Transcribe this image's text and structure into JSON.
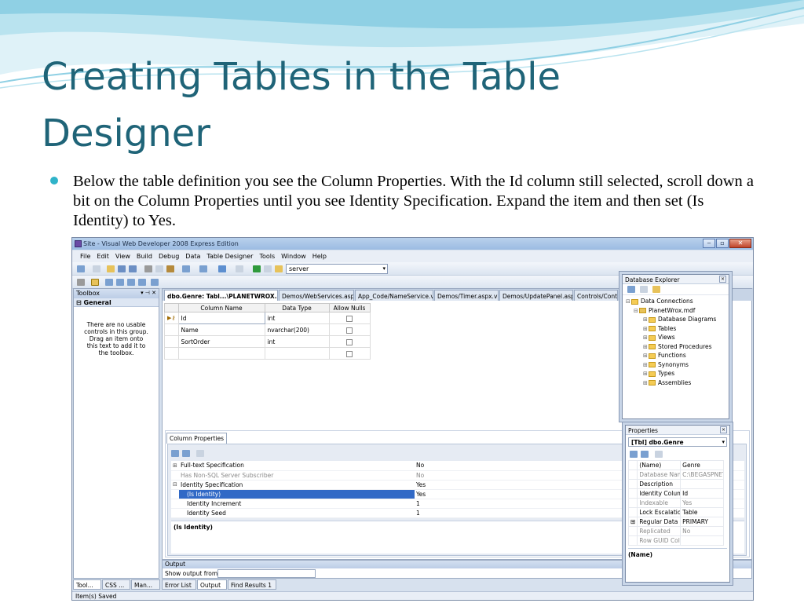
{
  "slide": {
    "title_line1": "Creating Tables in the Table",
    "title_line2": "Designer",
    "bullet": "Below the table definition you see the Column Properties. With the Id column still selected, scroll down a bit on the Column Properties until you see Identity Specification. Expand the item and then set (Is Identity) to Yes."
  },
  "colors": {
    "title": "#1f6478",
    "bullet": "#2fb3c9",
    "selection": "#3169c6"
  },
  "window": {
    "title": "Site - Visual Web Developer 2008 Express Edition",
    "menu": [
      "File",
      "Edit",
      "View",
      "Build",
      "Debug",
      "Data",
      "Table Designer",
      "Tools",
      "Window",
      "Help"
    ],
    "toolbar_combo": "server"
  },
  "toolbox": {
    "title": "Toolbox",
    "group": "General",
    "empty_msg": "There are no usable controls in this group. Drag an item onto this text to add it to the toolbox."
  },
  "doc_tabs": [
    "dbo.Genre: Tabl...\\PLANETWROX.MDF)",
    "Demos/WebServices.aspx",
    "App_Code/NameService.vb",
    "Demos/Timer.aspx.vb",
    "Demos/UpdatePanel.aspx",
    "Controls/Conta"
  ],
  "table_grid": {
    "headers": [
      "Column Name",
      "Data Type",
      "Allow Nulls"
    ],
    "rows": [
      {
        "name": "Id",
        "type": "int"
      },
      {
        "name": "Name",
        "type": "nvarchar(200)"
      },
      {
        "name": "SortOrder",
        "type": "int"
      }
    ]
  },
  "column_properties": {
    "tab": "Column Properties",
    "rows": [
      {
        "name": "Full-text Specification",
        "value": "No",
        "expander": "⊞",
        "indent": 0
      },
      {
        "name": "Has Non-SQL Server Subscriber",
        "value": "No",
        "expander": "",
        "indent": 0
      },
      {
        "name": "Identity Specification",
        "value": "Yes",
        "expander": "⊟",
        "indent": 0
      },
      {
        "name": "(Is Identity)",
        "value": "Yes",
        "expander": "",
        "indent": 1
      },
      {
        "name": "Identity Increment",
        "value": "1",
        "expander": "",
        "indent": 1
      },
      {
        "name": "Identity Seed",
        "value": "1",
        "expander": "",
        "indent": 1
      }
    ],
    "description": "(Is Identity)"
  },
  "output": {
    "title": "Output",
    "show_label": "Show output from:"
  },
  "bottom_tabs": [
    "Tool...",
    "CSS ...",
    "Man...",
    "Error List",
    "Output",
    "Find Results 1"
  ],
  "status": "Item(s) Saved",
  "db_explorer": {
    "title": "Database Explorer",
    "root": "Data Connections",
    "db": "PlanetWrox.mdf",
    "folders": [
      "Database Diagrams",
      "Tables",
      "Views",
      "Stored Procedures",
      "Functions",
      "Synonyms",
      "Types",
      "Assemblies"
    ]
  },
  "properties": {
    "title": "Properties",
    "object": "[Tbl] dbo.Genre",
    "rows": [
      {
        "name": "(Name)",
        "value": "Genre",
        "grey": false,
        "expander": ""
      },
      {
        "name": "Database Nam",
        "value": "C:\\BEGASPNET\\",
        "grey": true,
        "expander": ""
      },
      {
        "name": "Description",
        "value": "",
        "grey": false,
        "expander": ""
      },
      {
        "name": "Identity Colum",
        "value": "Id",
        "grey": false,
        "expander": ""
      },
      {
        "name": "Indexable",
        "value": "Yes",
        "grey": true,
        "expander": ""
      },
      {
        "name": "Lock Escalatior",
        "value": "Table",
        "grey": false,
        "expander": ""
      },
      {
        "name": "Regular Data Sp",
        "value": "PRIMARY",
        "grey": false,
        "expander": "⊞"
      },
      {
        "name": "Replicated",
        "value": "No",
        "grey": true,
        "expander": ""
      },
      {
        "name": "Row GUID Colu",
        "value": "",
        "grey": true,
        "expander": ""
      }
    ],
    "description": "(Name)"
  }
}
